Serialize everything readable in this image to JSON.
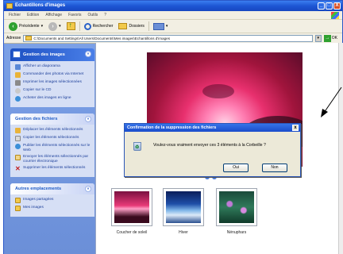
{
  "window": {
    "title": "Echantillons d'images",
    "buttons": [
      "_",
      "□",
      "X"
    ]
  },
  "menubar": {
    "items": [
      "Fichier",
      "Edition",
      "Affichage",
      "Favoris",
      "Outils",
      "?"
    ]
  },
  "toolbar": {
    "back_label": "Précédente",
    "search_label": "Rechercher",
    "folders_label": "Dossiers"
  },
  "address": {
    "label": "Adresse",
    "path": "C:\\Documents and Settings\\All Users\\Documents\\Mes images\\Echantillons d'images",
    "go_label": "OK"
  },
  "sidebar": {
    "image_tasks": {
      "title": "Gestion des images",
      "items": [
        "Afficher un diaporama",
        "Commander des photos via Internet",
        "Imprimer les images sélectionnées",
        "Copier sur le CD",
        "Acheter des images en ligne"
      ]
    },
    "file_tasks": {
      "title": "Gestion des fichiers",
      "items": [
        "Déplacer les éléments sélectionnés",
        "Copier les éléments sélectionnés",
        "Publier les éléments sélectionnés sur le Web",
        "Envoyer les éléments sélectionnés par courrier électronique",
        "Supprimer les éléments sélectionnés"
      ]
    },
    "other_places": {
      "title": "Autres emplacements",
      "items": [
        "Images partagées",
        "Mes images"
      ]
    }
  },
  "thumbnails": [
    {
      "label": "Coucher de soleil"
    },
    {
      "label": "Hiver"
    },
    {
      "label": "Nénuphars"
    }
  ],
  "dialog": {
    "title": "Confirmation de la suppression des fichiers",
    "message": "Voulez-vous vraiment envoyer ces 3 éléments à la Corbeille ?",
    "yes_label": "Oui",
    "no_label": "Non",
    "close_label": "x"
  },
  "colors": {
    "title_blue": "#1d55d4",
    "sidebar_blue": "#7ba0e6",
    "task_text": "#1c3f9a"
  }
}
